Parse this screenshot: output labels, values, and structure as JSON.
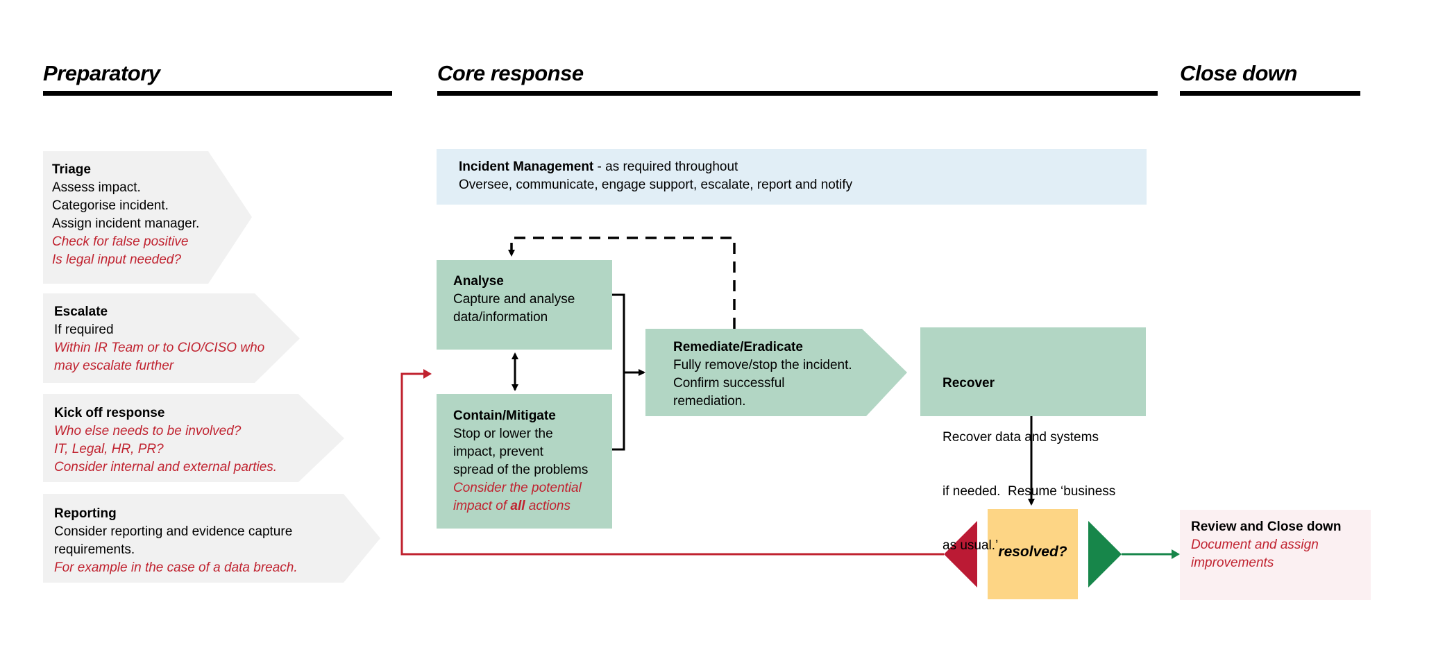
{
  "colors": {
    "prep_fill": "#f1f1f1",
    "incident_fill": "#e1eef6",
    "core_fill": "#b2d6c4",
    "resolved_fill": "#fdd585",
    "review_fill": "#fbf0f2",
    "red": "#c0222f",
    "red_triangle": "#bb1a34",
    "green": "#17864a",
    "black": "#000000"
  },
  "phases": [
    {
      "title": "Preparatory"
    },
    {
      "title": "Core response"
    },
    {
      "title": "Close down"
    }
  ],
  "preparatory": [
    {
      "heading": "Triage",
      "lines": [
        "Assess impact.",
        "Categorise incident.",
        "Assign incident manager."
      ],
      "notes": [
        "Check for false positive",
        "Is legal input needed?"
      ]
    },
    {
      "heading": "Escalate",
      "lines": [
        "If required"
      ],
      "notes": [
        "Within IR Team or to CIO/CISO who",
        "may escalate further"
      ]
    },
    {
      "heading": "Kick off response",
      "lines": [],
      "notes": [
        "Who else needs to be involved?",
        "IT, Legal, HR, PR?",
        "Consider internal and external parties."
      ]
    },
    {
      "heading": "Reporting",
      "lines": [
        "Consider reporting and evidence capture",
        "requirements."
      ],
      "notes": [
        "For example in the case of a data breach."
      ]
    }
  ],
  "incident_management": {
    "heading": "Incident Management",
    "heading_suffix": " - as required throughout",
    "line": "Oversee, communicate, engage support, escalate, report and notify"
  },
  "core": {
    "analyse": {
      "heading": "Analyse",
      "lines": [
        "Capture and analyse",
        "data/information"
      ]
    },
    "contain": {
      "heading": "Contain/Mitigate",
      "lines": [
        "Stop or lower the",
        "impact, prevent",
        "spread of the problems"
      ],
      "note_line1": "Consider the potential",
      "note_pre": "impact of ",
      "note_bold": "all",
      "note_post": " actions"
    },
    "remediate": {
      "heading": "Remediate/Eradicate",
      "lines": [
        "Fully remove/stop the incident.",
        "Confirm successful",
        "remediation."
      ]
    },
    "recover": {
      "heading": "Recover",
      "lines": [
        "Recover data and systems",
        "if needed.  Resume ‘business",
        "as usual.’"
      ]
    }
  },
  "decision": {
    "label": "resolved?",
    "no_icon": "left-triangle-red",
    "yes_icon": "right-triangle-green"
  },
  "close_down": {
    "heading": "Review and Close down",
    "notes": [
      "Document and assign",
      "improvements"
    ]
  }
}
